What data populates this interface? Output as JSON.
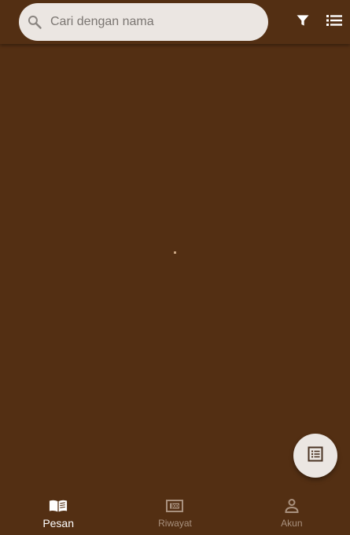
{
  "search": {
    "placeholder": "Cari dengan nama",
    "value": ""
  },
  "toolbar": {
    "filter_icon": "filter-icon",
    "list_icon": "list-view-icon"
  },
  "content": {
    "loading": true
  },
  "fab": {
    "icon": "list-alt-icon"
  },
  "bottom_nav": {
    "items": [
      {
        "label": "Pesan",
        "icon": "book-open-icon",
        "active": true
      },
      {
        "label": "Riwayat",
        "icon": "history-icon",
        "active": false
      },
      {
        "label": "Akun",
        "icon": "person-icon",
        "active": false
      }
    ]
  },
  "colors": {
    "background": "#532f13",
    "surface_light": "#ebe6e2",
    "nav_active": "#ffffff",
    "nav_inactive": "#a9917e",
    "loading_dot": "#c9a582"
  }
}
